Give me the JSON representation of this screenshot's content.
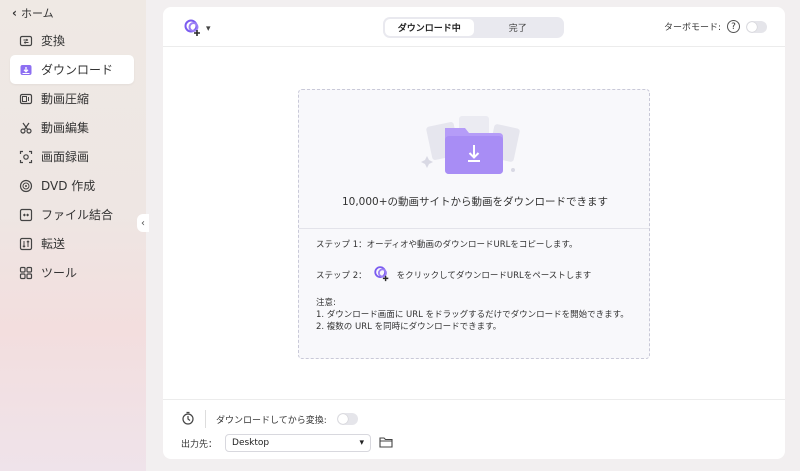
{
  "sidebar": {
    "home_label": "ホーム",
    "items": [
      {
        "label": "変換",
        "icon": "convert-icon"
      },
      {
        "label": "ダウンロード",
        "icon": "download-icon",
        "active": true
      },
      {
        "label": "動画圧縮",
        "icon": "compress-icon"
      },
      {
        "label": "動画編集",
        "icon": "scissors-icon"
      },
      {
        "label": "画面録画",
        "icon": "screen-record-icon"
      },
      {
        "label": "DVD 作成",
        "icon": "disc-icon"
      },
      {
        "label": "ファイル結合",
        "icon": "merge-icon"
      },
      {
        "label": "転送",
        "icon": "transfer-icon"
      },
      {
        "label": "ツール",
        "icon": "tools-icon"
      }
    ]
  },
  "toolbar": {
    "tabs": [
      "ダウンロード中",
      "完了"
    ],
    "active_tab": "ダウンロード中",
    "turbo_label": "ターボモード:",
    "help_glyph": "?",
    "turbo_enabled": false
  },
  "dropzone": {
    "headline": "10,000+の動画サイトから動画をダウンロードできます",
    "step1": "ステップ 1：オーディオや動画のダウンロードURLをコピーします。",
    "step2_prefix": "ステップ 2：",
    "step2_suffix": "をクリックしてダウンロードURLをペーストします",
    "notes_title": "注意:",
    "note1": "1. ダウンロード画面に URL をドラッグするだけでダウンロードを開始できます。",
    "note2": "2. 複数の URL を同時にダウンロードできます。"
  },
  "footer": {
    "convert_after_label": "ダウンロードしてから変換:",
    "convert_after_enabled": false,
    "output_label": "出力先：",
    "output_value": "Desktop"
  },
  "colors": {
    "accent": "#7b5cf0",
    "folder": "#a98ef5"
  }
}
